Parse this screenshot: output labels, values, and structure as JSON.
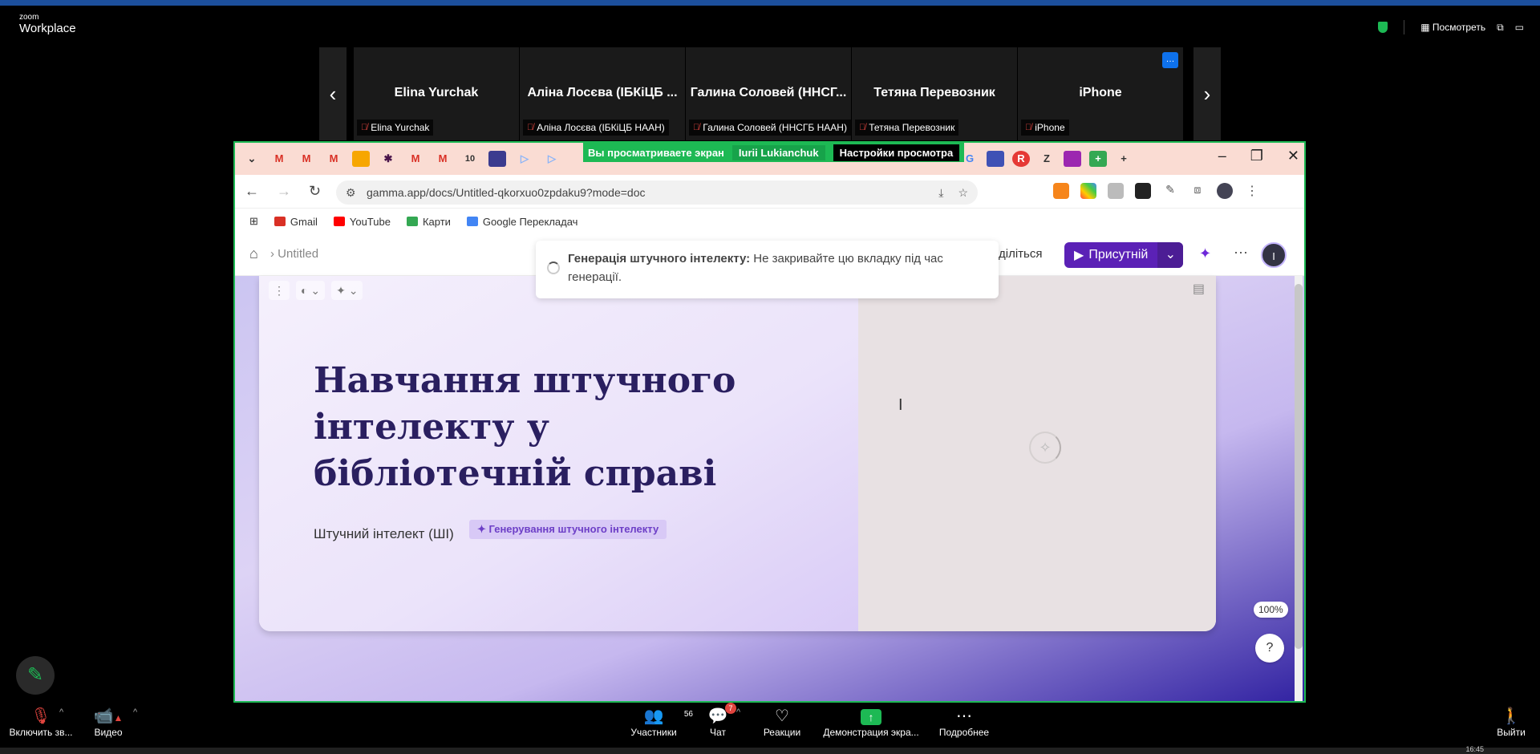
{
  "zoom": {
    "logo_small": "zoom",
    "logo_big": "Workplace",
    "view_label": "Посмотреть"
  },
  "participants": [
    {
      "name": "Elina Yurchak",
      "tag": "Elina Yurchak"
    },
    {
      "name": "Аліна Лосєва (ІБКіЦБ ...",
      "tag": "Аліна Лосєва (ІБКіЦБ НААН)"
    },
    {
      "name": "Галина Соловей (ННСГ...",
      "tag": "Галина Соловей (ННСГБ НААН)"
    },
    {
      "name": "Тетяна Перевозник",
      "tag": "Тетяна Перевозник"
    },
    {
      "name": "iPhone",
      "tag": "iPhone"
    }
  ],
  "share_banner": {
    "viewing": "Вы просматриваете экран",
    "presenter": "Iurii Lukianchuk",
    "settings": "Настройки просмотра"
  },
  "browser": {
    "url": "gamma.app/docs/Untitled-qkorxuo0zpdaku9?mode=doc",
    "bookmarks": [
      "Gmail",
      "YouTube",
      "Карти",
      "Google Перекладач"
    ]
  },
  "gamma": {
    "breadcrumb": "Untitled",
    "share_label": "діліться",
    "present_label": "Присутній",
    "avatar_initial": "I",
    "toast_bold": "Генерація штучного інтелекту:",
    "toast_text": " Не закривайте цю вкладку під час генерації.",
    "card_title": "Навчання штучного інтелекту у бібліотечній справі",
    "card_subtitle": "Штучний інтелект (ШІ)",
    "gen_chip": "✦ Генерування штучного інтелекту",
    "zoom_pct": "100%",
    "help": "?"
  },
  "toolbar": {
    "mute_label": "Включить зв...",
    "video_label": "Видео",
    "participants_label": "Участники",
    "participants_count": "56",
    "chat_label": "Чат",
    "chat_badge": "7",
    "reactions_label": "Реакции",
    "share_label": "Демонстрация экра...",
    "more_label": "Подробнее",
    "leave_label": "Выйти"
  },
  "clock": "16:45"
}
